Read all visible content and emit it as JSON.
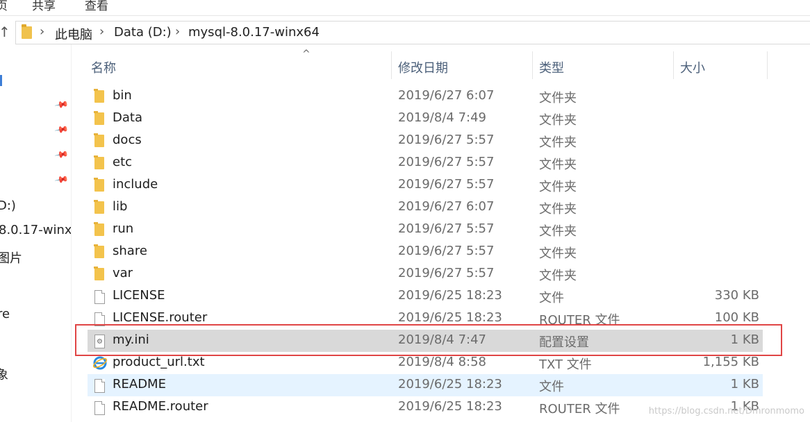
{
  "ribbon": {
    "tab1": "页",
    "tab2": "共享",
    "tab3": "查看"
  },
  "breadcrumb": [
    "此电脑",
    "Data (D:)",
    "mysql-8.0.17-winx64"
  ],
  "nav": {
    "items": [
      "D:)",
      "8.0.17-winx",
      "图片",
      "re",
      "象"
    ]
  },
  "headers": {
    "name": "名称",
    "date": "修改日期",
    "type": "类型",
    "size": "大小"
  },
  "files": [
    {
      "name": "bin",
      "date": "2019/6/27 6:07",
      "type": "文件夹",
      "size": "",
      "icon": "folder-icon"
    },
    {
      "name": "Data",
      "date": "2019/8/4 7:49",
      "type": "文件夹",
      "size": "",
      "icon": "folder-icon"
    },
    {
      "name": "docs",
      "date": "2019/6/27 5:57",
      "type": "文件夹",
      "size": "",
      "icon": "folder-icon"
    },
    {
      "name": "etc",
      "date": "2019/6/27 5:57",
      "type": "文件夹",
      "size": "",
      "icon": "folder-icon"
    },
    {
      "name": "include",
      "date": "2019/6/27 5:57",
      "type": "文件夹",
      "size": "",
      "icon": "folder-icon"
    },
    {
      "name": "lib",
      "date": "2019/6/27 6:07",
      "type": "文件夹",
      "size": "",
      "icon": "folder-icon"
    },
    {
      "name": "run",
      "date": "2019/6/27 5:57",
      "type": "文件夹",
      "size": "",
      "icon": "folder-icon"
    },
    {
      "name": "share",
      "date": "2019/6/27 5:57",
      "type": "文件夹",
      "size": "",
      "icon": "folder-icon"
    },
    {
      "name": "var",
      "date": "2019/6/27 5:57",
      "type": "文件夹",
      "size": "",
      "icon": "folder-icon"
    },
    {
      "name": "LICENSE",
      "date": "2019/6/25 18:23",
      "type": "文件",
      "size": "330 KB",
      "icon": "file-icon"
    },
    {
      "name": "LICENSE.router",
      "date": "2019/6/25 18:23",
      "type": "ROUTER 文件",
      "size": "100 KB",
      "icon": "file-icon"
    },
    {
      "name": "my.ini",
      "date": "2019/8/4 7:47",
      "type": "配置设置",
      "size": "1 KB",
      "icon": "settings-file-icon"
    },
    {
      "name": "product_url.txt",
      "date": "2019/8/4 8:58",
      "type": "TXT 文件",
      "size": "1,155 KB",
      "icon": "internet-explorer-icon"
    },
    {
      "name": "README",
      "date": "2019/6/25 18:23",
      "type": "文件",
      "size": "1 KB",
      "icon": "file-icon"
    },
    {
      "name": "README.router",
      "date": "2019/6/25 18:23",
      "type": "ROUTER 文件",
      "size": "1 KB",
      "icon": "file-icon"
    }
  ],
  "watermark": "https://blog.csdn.net/Dmronmomo",
  "colors": {
    "selection": "#d9d9d9",
    "hover": "#e5f3ff",
    "highlight_border": "#e04545",
    "folder": "#f3c34c"
  }
}
